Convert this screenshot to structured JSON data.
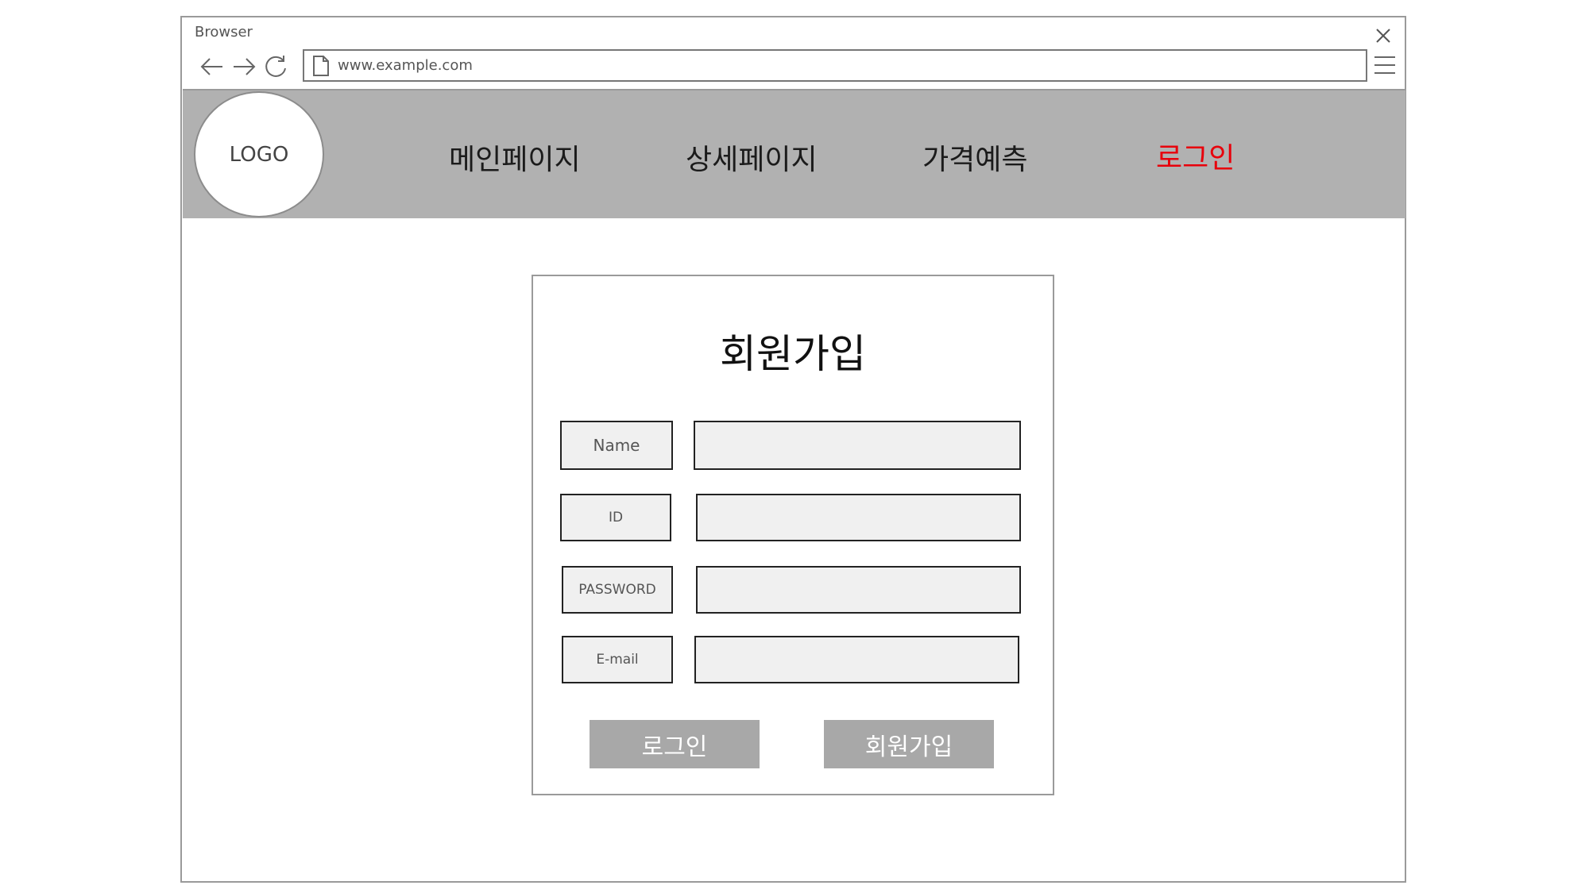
{
  "browser": {
    "title": "Browser",
    "address": "www.example.com"
  },
  "header": {
    "logo": "LOGO",
    "nav": [
      {
        "label": "메인페이지"
      },
      {
        "label": "상세페이지"
      },
      {
        "label": "가격예측"
      },
      {
        "label": "로그인",
        "active": true
      }
    ],
    "active_color": "#e8000b",
    "background": "#b1b1b1"
  },
  "signup": {
    "title": "회원가입",
    "fields": [
      {
        "label": "Name",
        "value": ""
      },
      {
        "label": "ID",
        "value": ""
      },
      {
        "label": "PASSWORD",
        "value": ""
      },
      {
        "label": "E-mail",
        "value": ""
      }
    ],
    "buttons": {
      "login": "로그인",
      "signup": "회원가입"
    }
  }
}
